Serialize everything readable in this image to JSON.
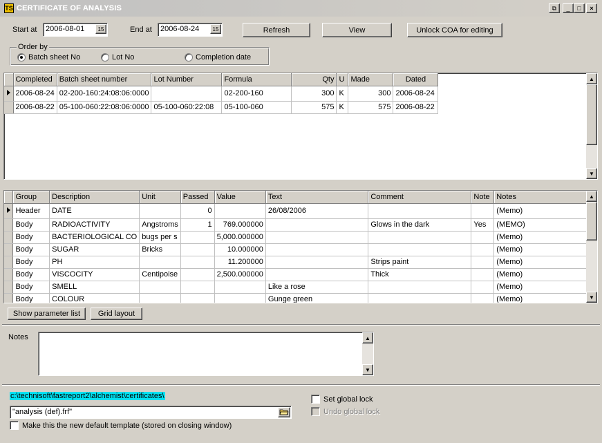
{
  "window": {
    "title": "CERTIFICATE OF ANALYSIS",
    "app_icon": "TS"
  },
  "filters": {
    "start_label": "Start at",
    "start_value": "2006-08-01",
    "end_label": "End at",
    "end_value": "2006-08-24",
    "calendar_glyph": "15"
  },
  "buttons": {
    "refresh": "Refresh",
    "view": "View",
    "unlock": "Unlock COA for editing",
    "show_params": "Show parameter list",
    "grid_layout": "Grid layout"
  },
  "order_by": {
    "label": "Order by",
    "options": [
      "Batch sheet No",
      "Lot No",
      "Completion date"
    ],
    "selected": "Batch sheet No"
  },
  "batches": {
    "columns": [
      "Completed",
      "Batch sheet number",
      "Lot Number",
      "Formula",
      "Qty",
      "U",
      "Made",
      "Dated"
    ],
    "rows": [
      [
        "2006-08-24",
        "02-200-160:24:08:06:0000",
        "",
        "02-200-160",
        "300",
        "K",
        "300",
        "2006-08-24"
      ],
      [
        "2006-08-22",
        "05-100-060:22:08:06:0000",
        "05-100-060:22:08",
        "05-100-060",
        "575",
        "K",
        "575",
        "2006-08-22"
      ]
    ]
  },
  "params": {
    "columns": [
      "Group",
      "Description",
      "Unit",
      "Passed",
      "Value",
      "Text",
      "Comment",
      "Note",
      "Notes"
    ],
    "rows": [
      [
        "Header",
        "DATE",
        "",
        "0",
        "",
        "26/08/2006",
        "",
        "",
        "(Memo)"
      ],
      [
        "Body",
        "RADIOACTIVITY",
        "Angstroms",
        "1",
        "769.000000",
        "",
        "Glows in the dark",
        "Yes",
        "(MEMO)"
      ],
      [
        "Body",
        "BACTERIOLOGICAL CO",
        "bugs per s",
        "",
        "5,000.000000",
        "",
        "",
        "",
        "(Memo)"
      ],
      [
        "Body",
        "SUGAR",
        "Bricks",
        "",
        "10.000000",
        "",
        "",
        "",
        "(Memo)"
      ],
      [
        "Body",
        "PH",
        "",
        "",
        "11.200000",
        "",
        "Strips paint",
        "",
        "(Memo)"
      ],
      [
        "Body",
        "VISCOCITY",
        "Centipoise",
        "",
        "2,500.000000",
        "",
        "Thick",
        "",
        "(Memo)"
      ],
      [
        "Body",
        "SMELL",
        "",
        "",
        "",
        "Like a rose",
        "",
        "",
        "(Memo)"
      ],
      [
        "Body",
        "COLOUR",
        "",
        "",
        "",
        "Gunge green",
        "",
        "",
        "(Memo)"
      ]
    ]
  },
  "notes": {
    "label": "Notes",
    "value": ""
  },
  "template": {
    "path": "c:\\technisoft\\fastreport2\\alchemist\\certificates\\",
    "file": "\"analysis (def).frf\"",
    "default_label": "Make this the new default template (stored on closing window)"
  },
  "locks": {
    "set_label": "Set global lock",
    "undo_label": "Undo global lock"
  }
}
